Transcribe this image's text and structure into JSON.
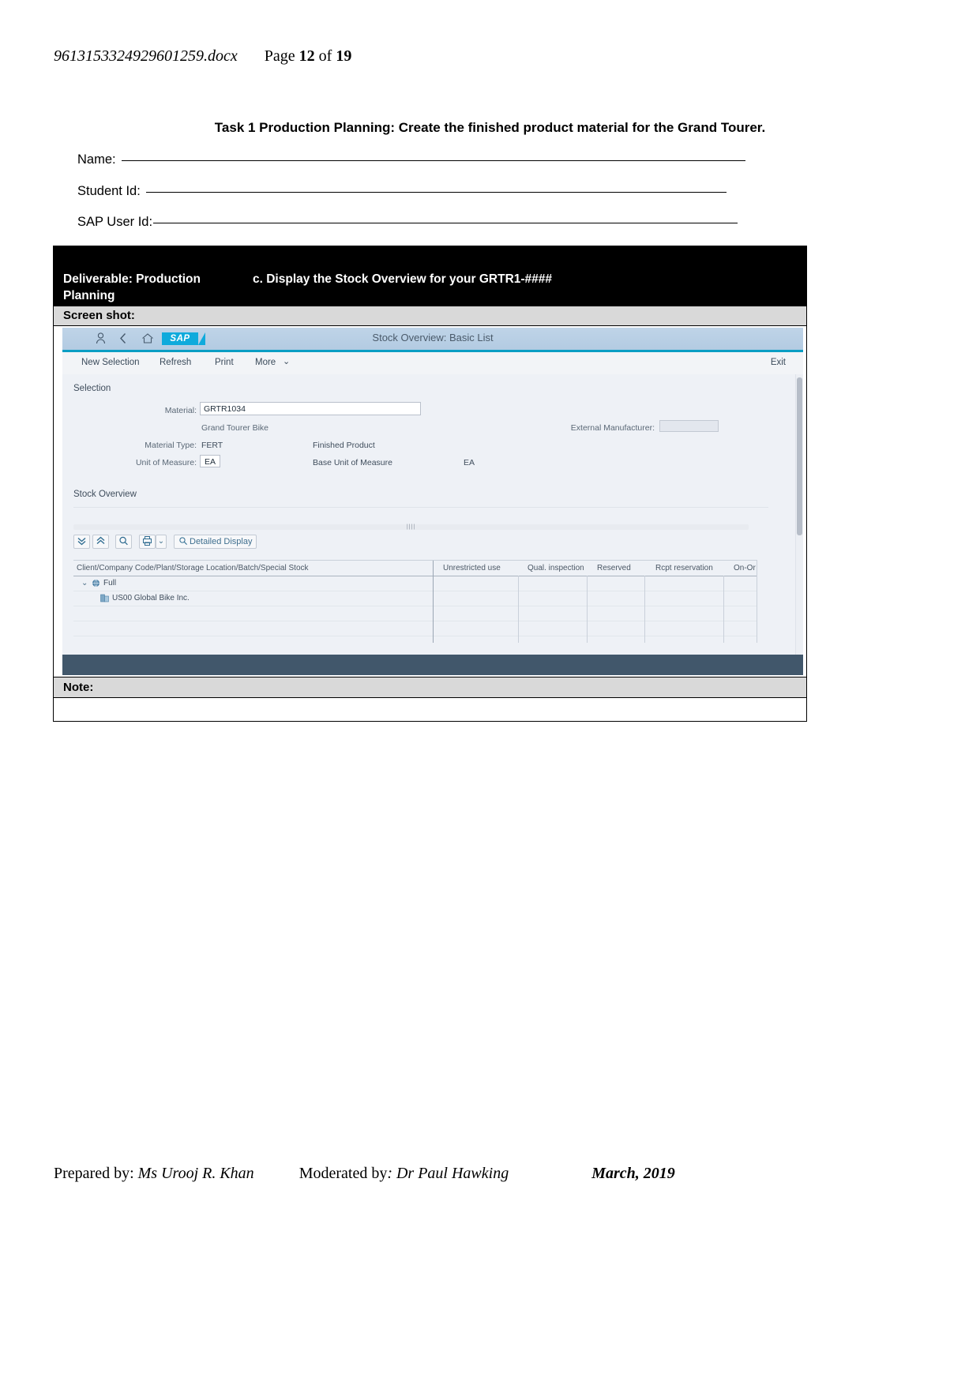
{
  "header": {
    "filename": "9613153324929601259.docx",
    "page_prefix": "Page",
    "page_number": "12",
    "page_of": "of",
    "page_total": "19"
  },
  "task": {
    "title": "Task 1 Production Planning: Create the finished product material for the Grand Tourer."
  },
  "form": {
    "name_label": "Name:",
    "student_label": "Student Id:",
    "sapuser_label": "SAP User Id:"
  },
  "deliverable": {
    "left_text": "Deliverable: Production Planning",
    "right_text": "c. Display the Stock Overview for your GRTR1-####",
    "screenshot_label": "Screen shot:",
    "note_label": "Note:"
  },
  "sap": {
    "shell": {
      "user_icon": "user-icon",
      "back_icon": "back-chevron-icon",
      "home_icon": "home-icon",
      "logo": "SAP",
      "title": "Stock Overview: Basic List"
    },
    "actions": {
      "new_selection": "New Selection",
      "refresh": "Refresh",
      "print": "Print",
      "more": "More",
      "more_chevron": "⌄",
      "exit": "Exit"
    },
    "selection": {
      "section_title": "Selection",
      "material_label": "Material:",
      "material_value": "GRTR1034",
      "material_desc": "Grand Tourer Bike",
      "external_manufacturer_label": "External Manufacturer:",
      "external_manufacturer_value": "",
      "material_type_label": "Material Type:",
      "material_type_value": "FERT",
      "material_type_desc": "Finished Product",
      "uom_label": "Unit of Measure:",
      "uom_value": "EA",
      "base_uom_label": "Base Unit of Measure",
      "base_uom_value": "EA"
    },
    "stock": {
      "section_title": "Stock Overview",
      "toolbar": {
        "expand_all": "»",
        "collapse_all": "«",
        "find": "search-icon",
        "print": "print-icon",
        "print_chevron": "⌄",
        "detailed_display_icon": "magnifier-detail-icon",
        "detailed_display": "Detailed Display"
      },
      "columns": [
        "Client/Company Code/Plant/Storage Location/Batch/Special Stock",
        "Unrestricted use",
        "Qual. inspection",
        "Reserved",
        "Rcpt reservation",
        "On-Or"
      ],
      "rows": [
        {
          "indent": 0,
          "expander": "⌄",
          "icon": "globe-icon",
          "label": "Full"
        },
        {
          "indent": 1,
          "expander": "",
          "icon": "company-icon",
          "label": "US00 Global Bike Inc."
        },
        {
          "indent": 1,
          "expander": "",
          "icon": "",
          "label": ""
        },
        {
          "indent": 1,
          "expander": "",
          "icon": "",
          "label": ""
        },
        {
          "indent": 1,
          "expander": "",
          "icon": "",
          "label": ""
        }
      ]
    }
  },
  "footer": {
    "prepared_label": "Prepared by:",
    "prepared_name": "Ms Urooj R. Khan",
    "moderated_label": "Moderated by",
    "moderated_name": ": Dr Paul Hawking",
    "date": "March, 2019"
  },
  "colors": {
    "sap_blue": "#0faadc",
    "shell_bg": "#b8cfe4",
    "accent_line": "#0a9ec4",
    "deliverable_bg": "#000000",
    "bar_bg": "#d9d9d9"
  }
}
